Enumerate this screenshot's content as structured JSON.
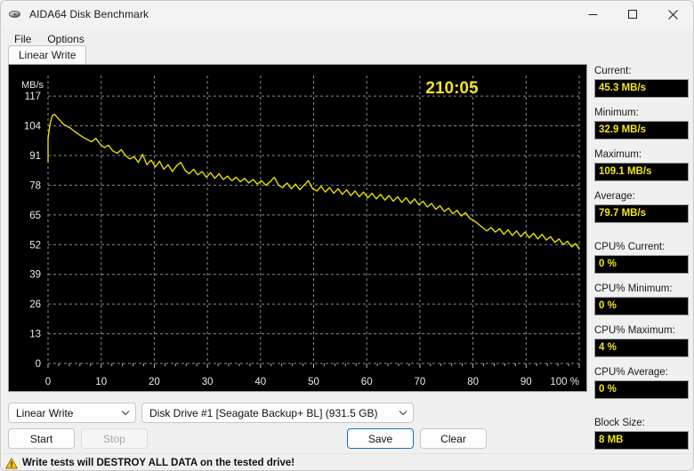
{
  "window": {
    "title": "AIDA64 Disk Benchmark",
    "icon": "disk-drive-icon",
    "minimize_label": "Minimize",
    "maximize_label": "Maximize",
    "close_label": "Close"
  },
  "menu": {
    "items": [
      {
        "label": "File"
      },
      {
        "label": "Options"
      }
    ]
  },
  "tabs": [
    {
      "label": "Linear Write",
      "active": true
    }
  ],
  "chart_data": {
    "type": "line",
    "title": "",
    "timer": "210:05",
    "xlabel": "",
    "ylabel": "MB/s",
    "x_unit": "%",
    "xlim": [
      0,
      100
    ],
    "ylim": [
      0,
      126
    ],
    "xticks": [
      0,
      10,
      20,
      30,
      40,
      50,
      60,
      70,
      80,
      90,
      100
    ],
    "xticklabels": [
      "0",
      "10",
      "20",
      "30",
      "40",
      "50",
      "60",
      "70",
      "80",
      "90",
      "100 %"
    ],
    "yticks": [
      0,
      13,
      26,
      39,
      52,
      65,
      78,
      91,
      104,
      117
    ],
    "yticklabels": [
      "0",
      "13",
      "26",
      "39",
      "52",
      "65",
      "78",
      "91",
      "104",
      "117"
    ],
    "grid": true,
    "grid_color": "#8c8c8c",
    "line_color": "#e8e000",
    "background": "#000000",
    "axis_text_color": "#e8e8f0",
    "legend": "none",
    "series": [
      {
        "name": "Linear Write",
        "x": [
          0.0,
          0.4,
          0.8,
          1.2,
          1.8,
          2.4,
          3.0,
          3.6,
          4.2,
          5.0,
          5.8,
          6.6,
          7.4,
          8.2,
          9.0,
          9.8,
          10.6,
          11.4,
          12.2,
          13.0,
          13.8,
          14.6,
          15.4,
          16.2,
          17.0,
          17.8,
          18.6,
          19.4,
          20.2,
          21.0,
          21.8,
          22.6,
          23.4,
          24.2,
          25.0,
          25.8,
          26.6,
          27.4,
          28.2,
          29.0,
          29.8,
          30.6,
          31.4,
          32.2,
          33.0,
          33.8,
          34.6,
          35.4,
          36.2,
          37.0,
          37.8,
          38.6,
          39.4,
          40.2,
          41.0,
          41.8,
          42.6,
          43.4,
          44.2,
          45.0,
          45.8,
          46.6,
          47.4,
          48.2,
          49.0,
          49.8,
          50.6,
          51.4,
          52.2,
          53.0,
          53.8,
          54.6,
          55.4,
          56.2,
          57.0,
          57.8,
          58.6,
          59.4,
          60.2,
          61.0,
          61.8,
          62.6,
          63.4,
          64.2,
          65.0,
          65.8,
          66.6,
          67.4,
          68.2,
          69.0,
          69.8,
          70.6,
          71.4,
          72.2,
          73.0,
          73.8,
          74.6,
          75.4,
          76.2,
          77.0,
          77.8,
          78.6,
          79.4,
          80.2,
          81.0,
          81.8,
          82.6,
          83.4,
          84.2,
          85.0,
          85.8,
          86.6,
          87.4,
          88.2,
          89.0,
          89.8,
          90.6,
          91.4,
          92.2,
          93.0,
          93.8,
          94.6,
          95.4,
          96.2,
          97.0,
          97.8,
          98.6,
          99.3,
          100.0
        ],
        "y": [
          98.5,
          105.0,
          108.5,
          109.1,
          107.5,
          106.0,
          104.5,
          103.8,
          103.0,
          101.5,
          100.2,
          99.0,
          98.0,
          97.0,
          98.5,
          96.0,
          94.5,
          95.5,
          93.0,
          92.0,
          93.5,
          91.0,
          89.5,
          90.5,
          88.0,
          91.5,
          87.0,
          89.0,
          86.0,
          88.5,
          85.0,
          87.0,
          84.0,
          86.5,
          88.0,
          84.5,
          83.0,
          85.0,
          82.5,
          84.0,
          81.5,
          83.5,
          81.0,
          83.0,
          80.5,
          82.0,
          80.0,
          81.5,
          79.5,
          81.0,
          79.0,
          80.5,
          78.5,
          80.0,
          78.0,
          79.5,
          81.5,
          78.0,
          77.0,
          79.0,
          76.5,
          78.5,
          76.0,
          78.0,
          80.0,
          76.5,
          75.5,
          77.5,
          75.0,
          77.0,
          74.5,
          76.5,
          74.0,
          76.0,
          73.5,
          75.5,
          73.0,
          75.0,
          72.5,
          74.5,
          72.0,
          74.0,
          71.5,
          73.5,
          71.0,
          73.0,
          70.5,
          72.5,
          70.0,
          72.0,
          69.5,
          71.0,
          68.5,
          70.0,
          67.5,
          69.0,
          66.5,
          68.0,
          65.5,
          67.0,
          64.5,
          66.0,
          63.5,
          62.5,
          61.0,
          59.5,
          58.0,
          59.5,
          57.5,
          59.0,
          56.5,
          58.5,
          56.0,
          58.0,
          55.5,
          57.5,
          55.0,
          57.0,
          54.5,
          56.5,
          54.0,
          55.5,
          53.0,
          54.5,
          52.0,
          53.5,
          51.0,
          52.5,
          50.0,
          51.5,
          48.5,
          50.0,
          47.0,
          45.3
        ]
      }
    ]
  },
  "stats": [
    {
      "label": "Current:",
      "value": "45.3 MB/s",
      "name": "current"
    },
    {
      "label": "Minimum:",
      "value": "32.9 MB/s",
      "name": "minimum"
    },
    {
      "label": "Maximum:",
      "value": "109.1 MB/s",
      "name": "maximum"
    },
    {
      "label": "Average:",
      "value": "79.7 MB/s",
      "name": "average"
    },
    {
      "label": "CPU% Current:",
      "value": "0 %",
      "name": "cpu-current"
    },
    {
      "label": "CPU% Minimum:",
      "value": "0 %",
      "name": "cpu-minimum"
    },
    {
      "label": "CPU% Maximum:",
      "value": "4 %",
      "name": "cpu-maximum"
    },
    {
      "label": "CPU% Average:",
      "value": "0 %",
      "name": "cpu-average"
    },
    {
      "label": "Block Size:",
      "value": "8 MB",
      "name": "block-size"
    }
  ],
  "controls": {
    "test_select": {
      "value": "Linear Write"
    },
    "drive_select": {
      "value": "Disk Drive #1  [Seagate Backup+ BL]  (931.5 GB)"
    },
    "start_label": "Start",
    "stop_label": "Stop",
    "save_label": "Save",
    "clear_label": "Clear"
  },
  "warning": {
    "icon": "warning-triangle-icon",
    "text": "Write tests will DESTROY ALL DATA on the tested drive!"
  },
  "colors": {
    "accent_yellow": "#e8e000",
    "value_yellow": "#f2e41e",
    "plot_bg": "#000000",
    "grid": "#8c8c8c",
    "primary_border": "#1a6fc4"
  }
}
